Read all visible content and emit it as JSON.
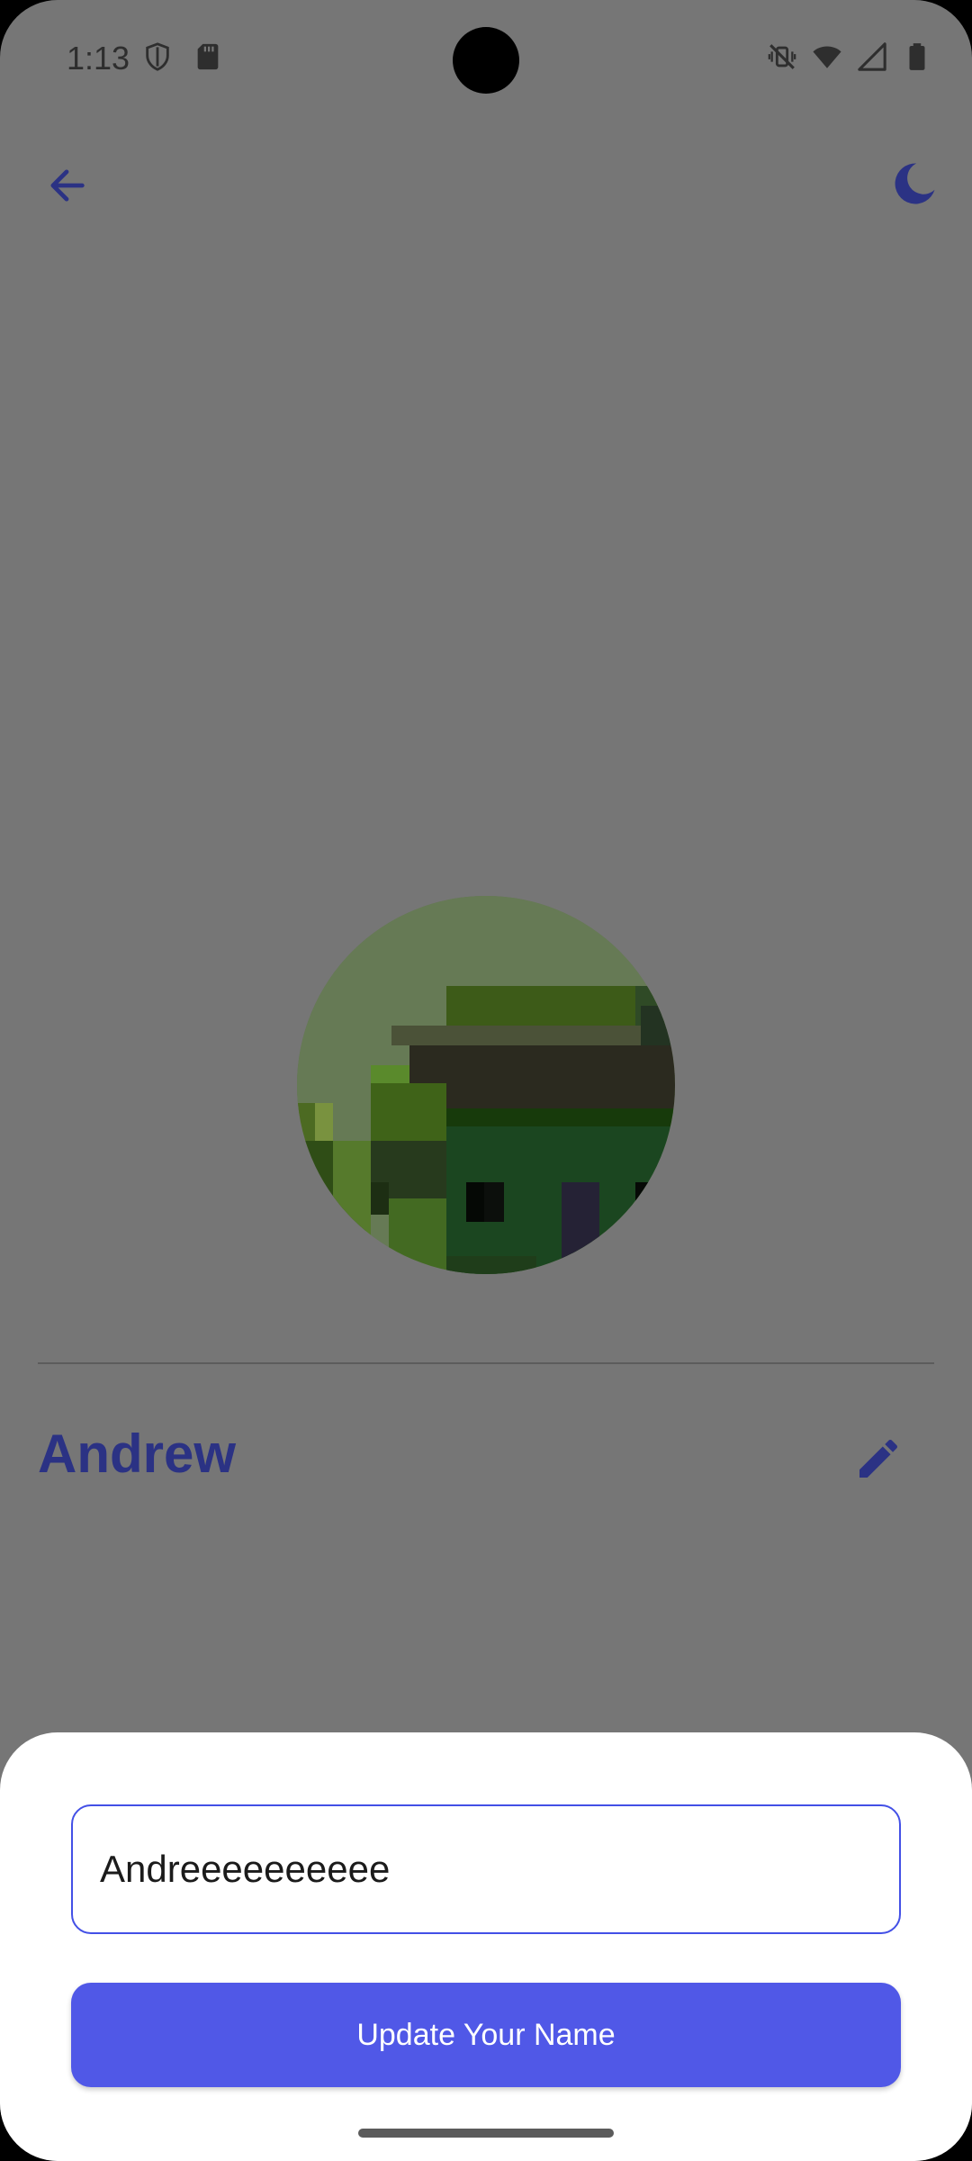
{
  "status_bar": {
    "time": "1:13",
    "icons_left": [
      "shield-icon",
      "sd-card-icon"
    ],
    "icons_right": [
      "vibrate-off-icon",
      "wifi-icon",
      "signal-icon",
      "battery-icon"
    ]
  },
  "top_bar": {
    "back_icon": "arrow-back-icon",
    "theme_icon": "moon-icon"
  },
  "profile": {
    "name": "Andrew",
    "edit_icon": "pencil-icon"
  },
  "bottom_sheet": {
    "name_input_value": "Andreeeeeeeeee",
    "update_button_label": "Update Your Name"
  },
  "colors": {
    "accent": "#5058e7",
    "name_text": "#2b3284",
    "scrim_background": "#767676"
  }
}
